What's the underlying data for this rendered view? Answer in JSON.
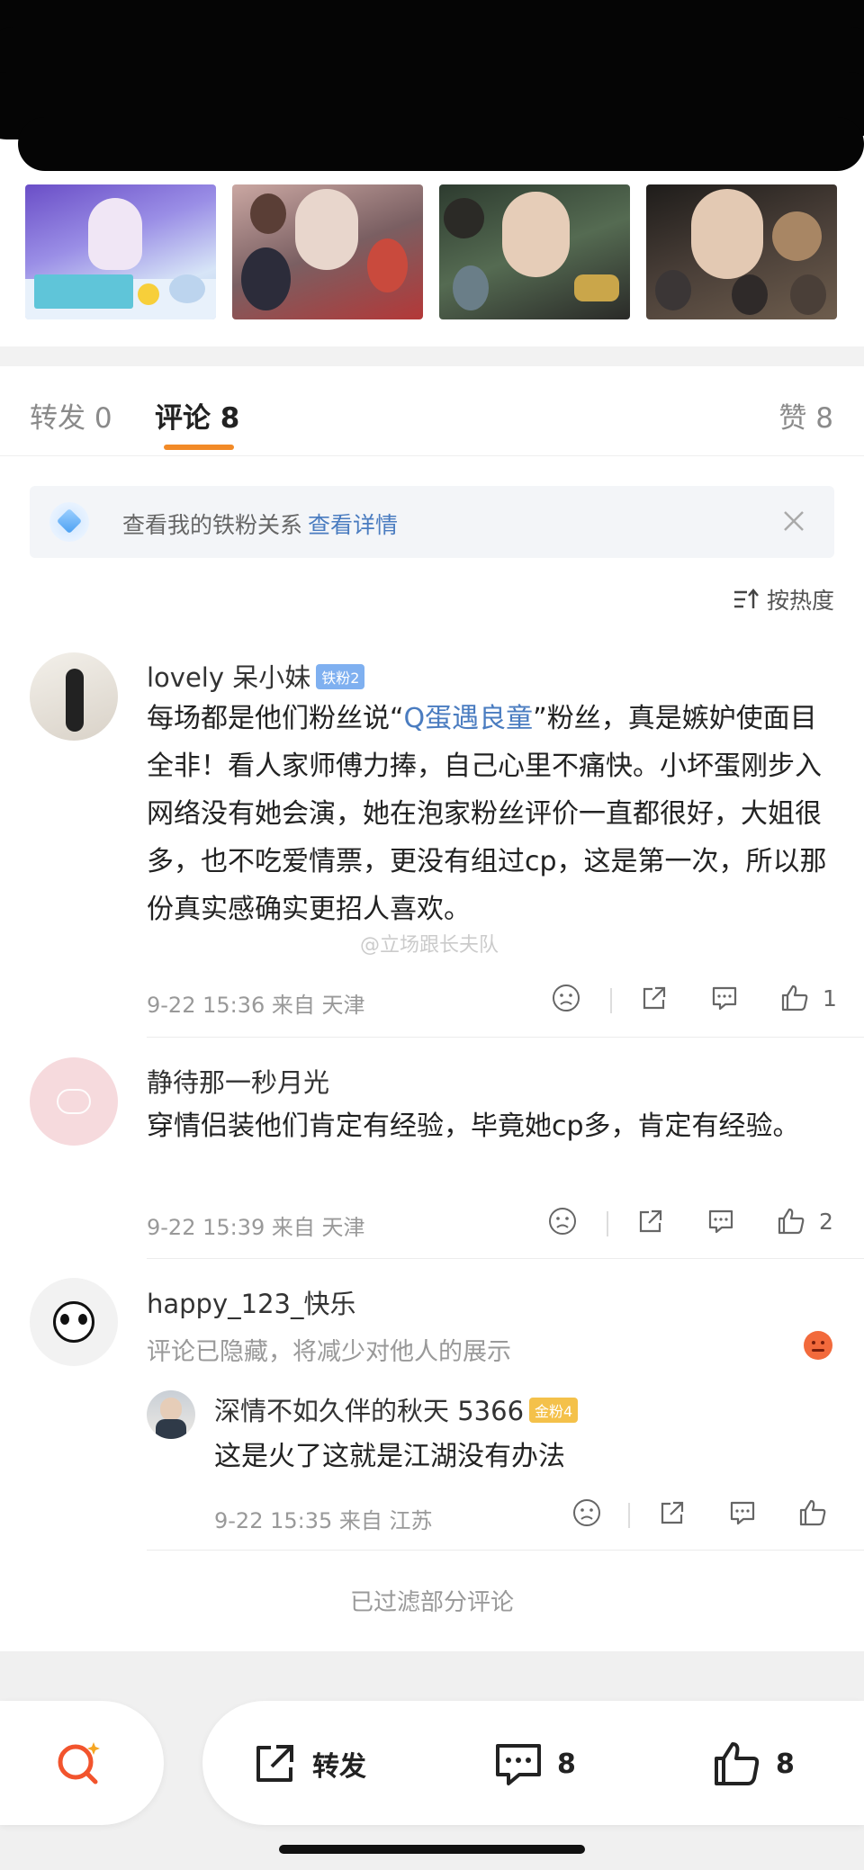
{
  "tabs": {
    "repost": "转发 0",
    "comment": "评论 8",
    "like": "赞 8"
  },
  "banner": {
    "text": "查看我的铁粉关系",
    "link": "查看详情"
  },
  "sort_label": "按热度",
  "watermark": "@立场跟长夫队",
  "comments": [
    {
      "user": "lovely 呆小妹",
      "badge": "铁粉2",
      "text_before": "每场都是他们粉丝说“",
      "topic": "Q蛋遇良童",
      "text_after": "”粉丝，真是嫉妒使面目全非！看人家师傅力捧，自己心里不痛快。小坏蛋刚步入网络没有她会演，她在泡家粉丝评价一直都很好，大姐很多，也不吃爱情票，更没有组过cp，这是第一次，所以那份真实感确实更招人喜欢。",
      "meta": "9-22 15:36 来自 天津",
      "likes": "1"
    },
    {
      "user": "静待那一秒月光",
      "text": "穿情侣装他们肯定有经验，毕竟她cp多，肯定有经验。",
      "meta": "9-22 15:39 来自 天津",
      "likes": "2"
    },
    {
      "user": "happy_123_快乐",
      "hidden_note": "评论已隐藏，将减少对他人的展示",
      "reply": {
        "user": "深情不如久伴的秋天 5366",
        "badge": "金粉4",
        "text": "这是火了这就是江湖没有办法",
        "meta": "9-22 15:35 来自 江苏"
      }
    }
  ],
  "filtered_note": "已过滤部分评论",
  "bottom_bar": {
    "repost_label": "转发",
    "comment_count": "8",
    "like_count": "8"
  }
}
